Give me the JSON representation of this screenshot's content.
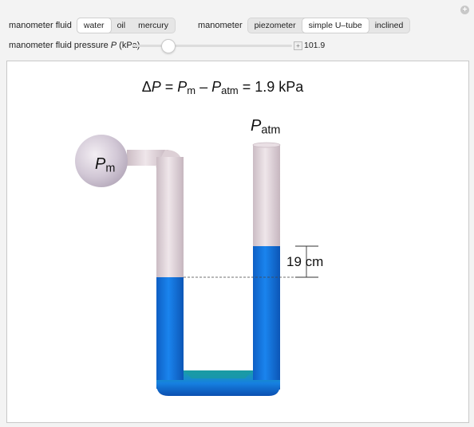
{
  "controls": {
    "fluid_label": "manometer fluid",
    "fluid_options": [
      "water",
      "oil",
      "mercury"
    ],
    "fluid_selected": "water",
    "manometer_label": "manometer",
    "manometer_options": [
      "piezometer",
      "simple U–tube",
      "inclined"
    ],
    "manometer_selected": "simple U–tube",
    "pressure_label_pre": "manometer fluid pressure ",
    "pressure_label_var": "P",
    "pressure_label_post": " (kPa)",
    "pressure_value": "101.9",
    "pressure_fraction": 0.22
  },
  "display": {
    "eq_lhs_delta": "Δ",
    "eq_P": "P",
    "eq_eq1": " = ",
    "eq_Pm": "P",
    "eq_sub_m": "m",
    "eq_minus": " – ",
    "eq_Patm": "P",
    "eq_sub_atm": "atm",
    "eq_result": " = 1.9 kPa",
    "pm_var": "P",
    "pm_sub": "m",
    "patm_var": "P",
    "patm_sub": "atm",
    "height_label": "19 cm"
  },
  "colors": {
    "fluid": "#1478e0",
    "fluid_dark": "#0b4fb0",
    "fluid_teal": "#1a9aa4",
    "tube": "#e3d6dc",
    "bulb": "#cfc6d6"
  }
}
